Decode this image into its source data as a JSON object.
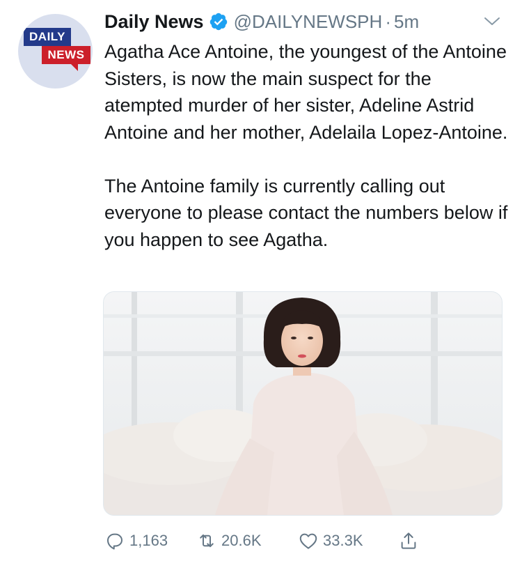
{
  "avatar": {
    "line1": "DAILY",
    "line2": "NEWS"
  },
  "account": {
    "name": "Daily News",
    "handle": "@DAILYNEWSPH",
    "separator": "·",
    "time": "5m"
  },
  "tweet": {
    "paragraph1": "Agatha Ace Antoine, the youngest of the Antoine Sisters, is now the main suspect for the atempted murder of her sister, Adeline Astrid Antoine and her mother, Adelaila Lopez-Antoine.",
    "paragraph2": "The Antoine family is currently calling out everyone to please contact the numbers below if you happen to see Agatha."
  },
  "actions": {
    "replies": "1,163",
    "retweets": "20.6K",
    "likes": "33.3K"
  },
  "icons": {
    "verified": "verified-badge-icon",
    "menu": "chevron-down-icon",
    "reply": "reply-icon",
    "retweet": "retweet-icon",
    "like": "heart-icon",
    "share": "share-icon"
  },
  "colors": {
    "verified": "#1da1f2",
    "muted": "#657786",
    "logo_blue": "#233a8a",
    "logo_red": "#cc1f2a"
  }
}
